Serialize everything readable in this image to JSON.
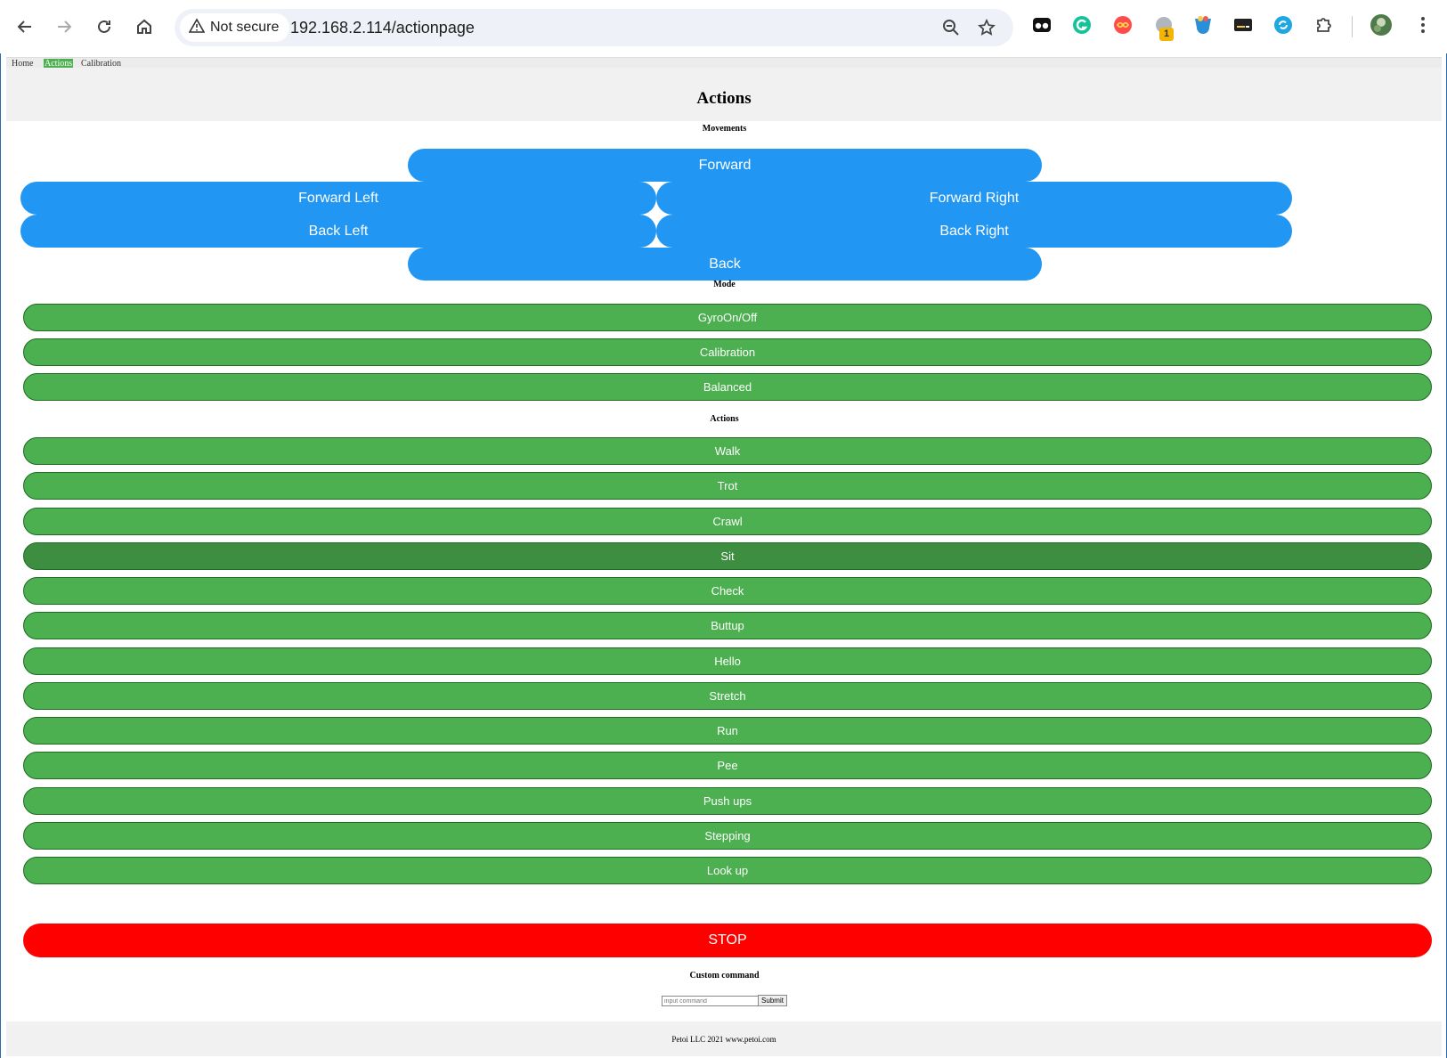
{
  "browser": {
    "security_label": "Not secure",
    "url": "192.168.2.114/actionpage",
    "extension_badge": "1",
    "icons": [
      "back-icon",
      "forward-icon",
      "reload-icon",
      "home-icon",
      "warning-icon",
      "zoom-icon",
      "star-icon",
      "extension-tab-icon",
      "grammarly-icon",
      "infinity-icon",
      "extension-badge-icon",
      "globe-ext-icon",
      "card-ext-icon",
      "sync-ext-icon",
      "puzzle-icon",
      "profile-avatar",
      "menu-icon"
    ]
  },
  "nav": {
    "home": "Home",
    "actions": "Actions",
    "calibration": "Calibration"
  },
  "page_title": "Actions",
  "sections": {
    "movements": "Movements",
    "mode": "Mode",
    "actions": "Actions",
    "custom": "Custom command"
  },
  "movements": {
    "forward": "Forward",
    "forward_left": "Forward Left",
    "forward_right": "Forward Right",
    "back_left": "Back Left",
    "back_right": "Back Right",
    "back": "Back"
  },
  "mode_buttons": [
    "GyroOn/Off",
    "Calibration",
    "Balanced"
  ],
  "action_buttons": [
    "Walk",
    "Trot",
    "Crawl",
    "Sit",
    "Check",
    "Buttup",
    "Hello",
    "Stretch",
    "Run",
    "Pee",
    "Push ups",
    "Stepping",
    "Look up"
  ],
  "stop_label": "STOP",
  "custom_command": {
    "placeholder": "input command",
    "submit": "Submit"
  },
  "footer": "Petoi LLC 2021 www.petoi.com",
  "colors": {
    "blue": "#2196F3",
    "green": "#4CAF50",
    "green_hover": "#3e8e41",
    "red": "#ff0000"
  }
}
